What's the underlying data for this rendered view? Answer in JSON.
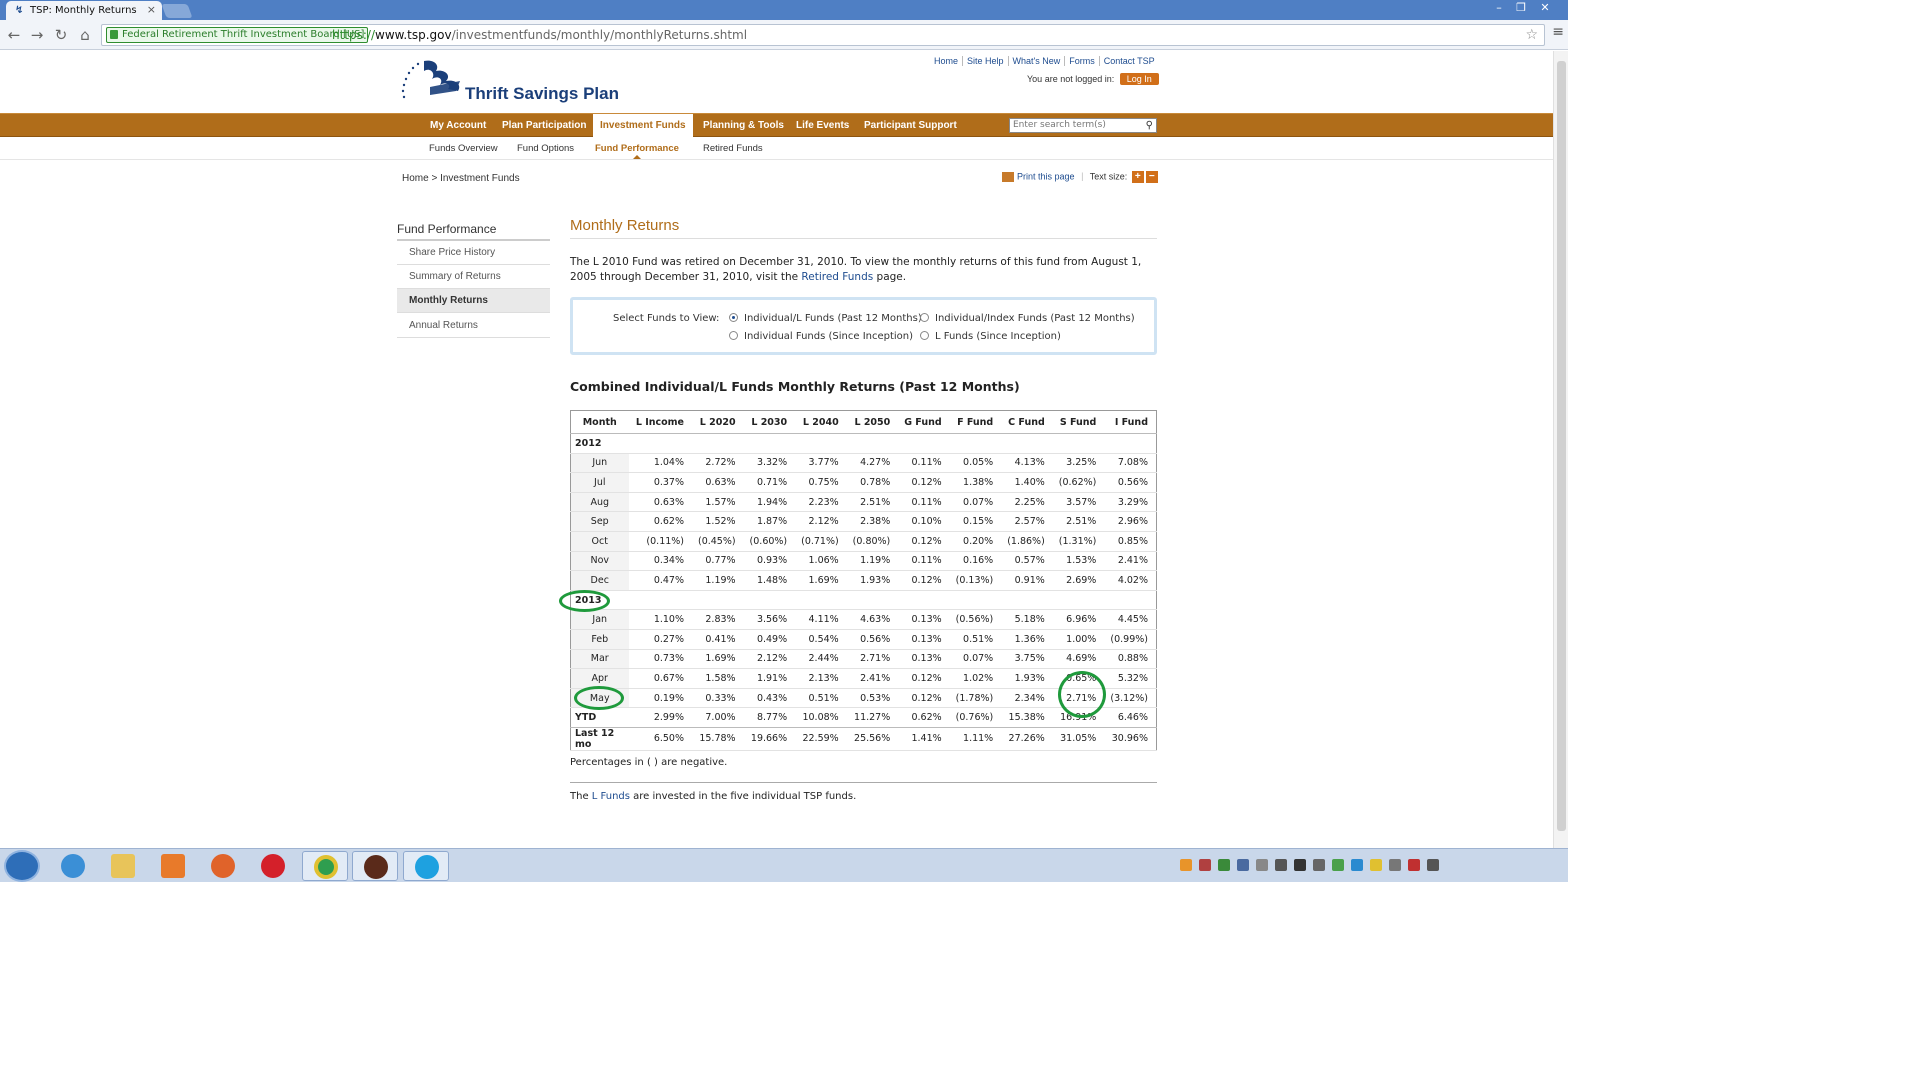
{
  "browser": {
    "tab_title": "TSP: Monthly Returns",
    "ev_label": "Federal Retirement Thrift Investment Board [US]",
    "url_scheme": "https://",
    "url_host": "www.tsp.gov",
    "url_path": "/investmentfunds/monthly/monthlyReturns.shtml"
  },
  "site": {
    "logo_text": "Thrift Savings Plan",
    "util_nav": [
      "Home",
      "Site Help",
      "What's New",
      "Forms",
      "Contact TSP"
    ],
    "login_status": "You are not logged in:",
    "login_button": "Log In",
    "main_nav": [
      "My Account",
      "Plan Participation",
      "Investment Funds",
      "Planning & Tools",
      "Life Events",
      "Participant Support"
    ],
    "search_placeholder": "Enter search term(s)",
    "sub_nav": [
      "Funds Overview",
      "Fund Options",
      "Fund Performance",
      "Retired Funds"
    ],
    "breadcrumb": [
      "Home",
      ">",
      "Investment Funds"
    ],
    "print_label": "Print this page",
    "text_size_label": "Text size:",
    "text_plus": "+",
    "text_minus": "−"
  },
  "sidebar": {
    "heading": "Fund Performance",
    "items": [
      "Share Price History",
      "Summary of Returns",
      "Monthly Returns",
      "Annual Returns"
    ]
  },
  "content": {
    "title": "Monthly Returns",
    "intro_1": "The L 2010 Fund was retired on December 31, 2010. To view the monthly returns of this fund from August 1, 2005 through December 31, 2010, visit the ",
    "intro_link": "Retired Funds",
    "intro_2": " page.",
    "select_label": "Select Funds to View:",
    "radios": [
      {
        "label": "Individual/L Funds (Past 12 Months)",
        "checked": true
      },
      {
        "label": "Individual/Index Funds (Past 12 Months)",
        "checked": false
      },
      {
        "label": "Individual Funds (Since Inception)",
        "checked": false
      },
      {
        "label": "L Funds (Since Inception)",
        "checked": false
      }
    ],
    "table_title": "Combined Individual/L Funds Monthly Returns (Past 12 Months)",
    "table": {
      "headers": [
        "Month",
        "L Income",
        "L 2020",
        "L 2030",
        "L 2040",
        "L 2050",
        "G Fund",
        "F Fund",
        "C Fund",
        "S Fund",
        "I Fund"
      ],
      "groups": [
        {
          "year": "2012",
          "rows": [
            [
              "Jun",
              "1.04%",
              "2.72%",
              "3.32%",
              "3.77%",
              "4.27%",
              "0.11%",
              "0.05%",
              "4.13%",
              "3.25%",
              "7.08%"
            ],
            [
              "Jul",
              "0.37%",
              "0.63%",
              "0.71%",
              "0.75%",
              "0.78%",
              "0.12%",
              "1.38%",
              "1.40%",
              "(0.62%)",
              "0.56%"
            ],
            [
              "Aug",
              "0.63%",
              "1.57%",
              "1.94%",
              "2.23%",
              "2.51%",
              "0.11%",
              "0.07%",
              "2.25%",
              "3.57%",
              "3.29%"
            ],
            [
              "Sep",
              "0.62%",
              "1.52%",
              "1.87%",
              "2.12%",
              "2.38%",
              "0.10%",
              "0.15%",
              "2.57%",
              "2.51%",
              "2.96%"
            ],
            [
              "Oct",
              "(0.11%)",
              "(0.45%)",
              "(0.60%)",
              "(0.71%)",
              "(0.80%)",
              "0.12%",
              "0.20%",
              "(1.86%)",
              "(1.31%)",
              "0.85%"
            ],
            [
              "Nov",
              "0.34%",
              "0.77%",
              "0.93%",
              "1.06%",
              "1.19%",
              "0.11%",
              "0.16%",
              "0.57%",
              "1.53%",
              "2.41%"
            ],
            [
              "Dec",
              "0.47%",
              "1.19%",
              "1.48%",
              "1.69%",
              "1.93%",
              "0.12%",
              "(0.13%)",
              "0.91%",
              "2.69%",
              "4.02%"
            ]
          ]
        },
        {
          "year": "2013",
          "rows": [
            [
              "Jan",
              "1.10%",
              "2.83%",
              "3.56%",
              "4.11%",
              "4.63%",
              "0.13%",
              "(0.56%)",
              "5.18%",
              "6.96%",
              "4.45%"
            ],
            [
              "Feb",
              "0.27%",
              "0.41%",
              "0.49%",
              "0.54%",
              "0.56%",
              "0.13%",
              "0.51%",
              "1.36%",
              "1.00%",
              "(0.99%)"
            ],
            [
              "Mar",
              "0.73%",
              "1.69%",
              "2.12%",
              "2.44%",
              "2.71%",
              "0.13%",
              "0.07%",
              "3.75%",
              "4.69%",
              "0.88%"
            ],
            [
              "Apr",
              "0.67%",
              "1.58%",
              "1.91%",
              "2.13%",
              "2.41%",
              "0.12%",
              "1.02%",
              "1.93%",
              "0.65%",
              "5.32%"
            ],
            [
              "May",
              "0.19%",
              "0.33%",
              "0.43%",
              "0.51%",
              "0.53%",
              "0.12%",
              "(1.78%)",
              "2.34%",
              "2.71%",
              "(3.12%)"
            ]
          ]
        }
      ],
      "totals": [
        [
          "YTD",
          "2.99%",
          "7.00%",
          "8.77%",
          "10.08%",
          "11.27%",
          "0.62%",
          "(0.76%)",
          "15.38%",
          "16.91%",
          "6.46%"
        ],
        [
          "Last 12 mo",
          "6.50%",
          "15.78%",
          "19.66%",
          "22.59%",
          "25.56%",
          "1.41%",
          "1.11%",
          "27.26%",
          "31.05%",
          "30.96%"
        ]
      ]
    },
    "neg_note": "Percentages in (   ) are negative.",
    "lfund_pre": "The ",
    "lfund_link": "L Funds",
    "lfund_post": " are invested in the five individual TSP funds."
  },
  "colors": {
    "brand_orange": "#b06d1a",
    "brand_blue": "#1b3f7a",
    "annotation_green": "#1f9a3c"
  },
  "taskbar": {
    "apps": [
      "internet-explorer-icon",
      "file-explorer-icon",
      "media-player-icon",
      "firefox-icon",
      "opera-icon",
      "chrome-icon",
      "app-icon",
      "skype-icon"
    ]
  }
}
